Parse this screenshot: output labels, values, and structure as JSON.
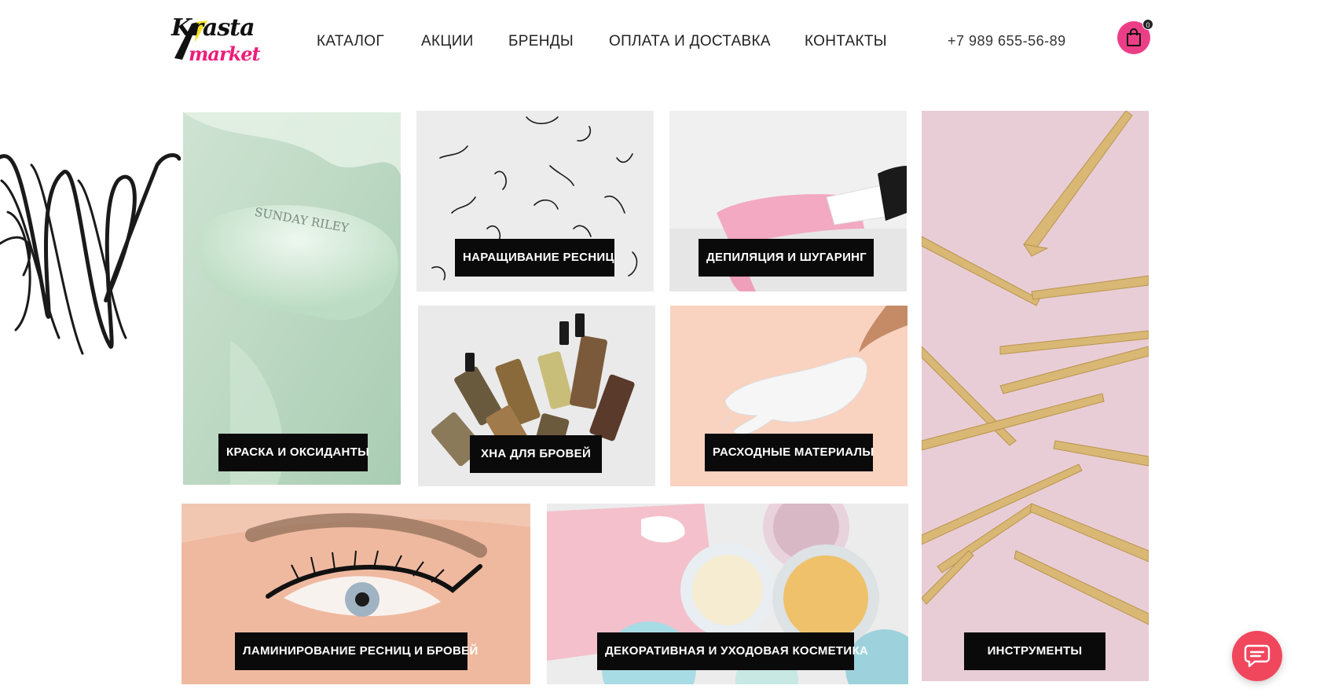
{
  "brand": {
    "logo_line1": "Krasta",
    "logo_line2": "market"
  },
  "nav": {
    "items": [
      {
        "label": "КАТАЛОГ"
      },
      {
        "label": "АКЦИИ"
      },
      {
        "label": "БРЕНДЫ"
      },
      {
        "label": "ОПЛАТА И ДОСТАВКА"
      },
      {
        "label": "КОНТАКТЫ"
      }
    ]
  },
  "phone": "+7 989 655-56-89",
  "cart": {
    "count": "0",
    "icon": "shopping-bag-icon"
  },
  "categories": [
    {
      "label": "КРАСКА И ОКСИДАНТЫ"
    },
    {
      "label": "НАРАЩИВАНИЕ РЕСНИЦ"
    },
    {
      "label": "ДЕПИЛЯЦИЯ И ШУГАРИНГ"
    },
    {
      "label": "ИНСТРУМЕНТЫ"
    },
    {
      "label": "ХНА ДЛЯ БРОВЕЙ"
    },
    {
      "label": "РАСХОДНЫЕ МАТЕРИАЛЫ"
    },
    {
      "label": "ЛАМИНИРОВАНИЕ РЕСНИЦ И БРОВЕЙ"
    },
    {
      "label": "ДЕКОРАТИВНАЯ И УХОДОВАЯ КОСМЕТИКА"
    }
  ],
  "image_text": {
    "cream_brand": "SUNDAY RILEY"
  },
  "colors": {
    "accent": "#ec3e86",
    "chat": "#f0475d",
    "label_bg": "#0a0a0a"
  },
  "chat": {
    "icon": "chat-bubble-icon"
  }
}
